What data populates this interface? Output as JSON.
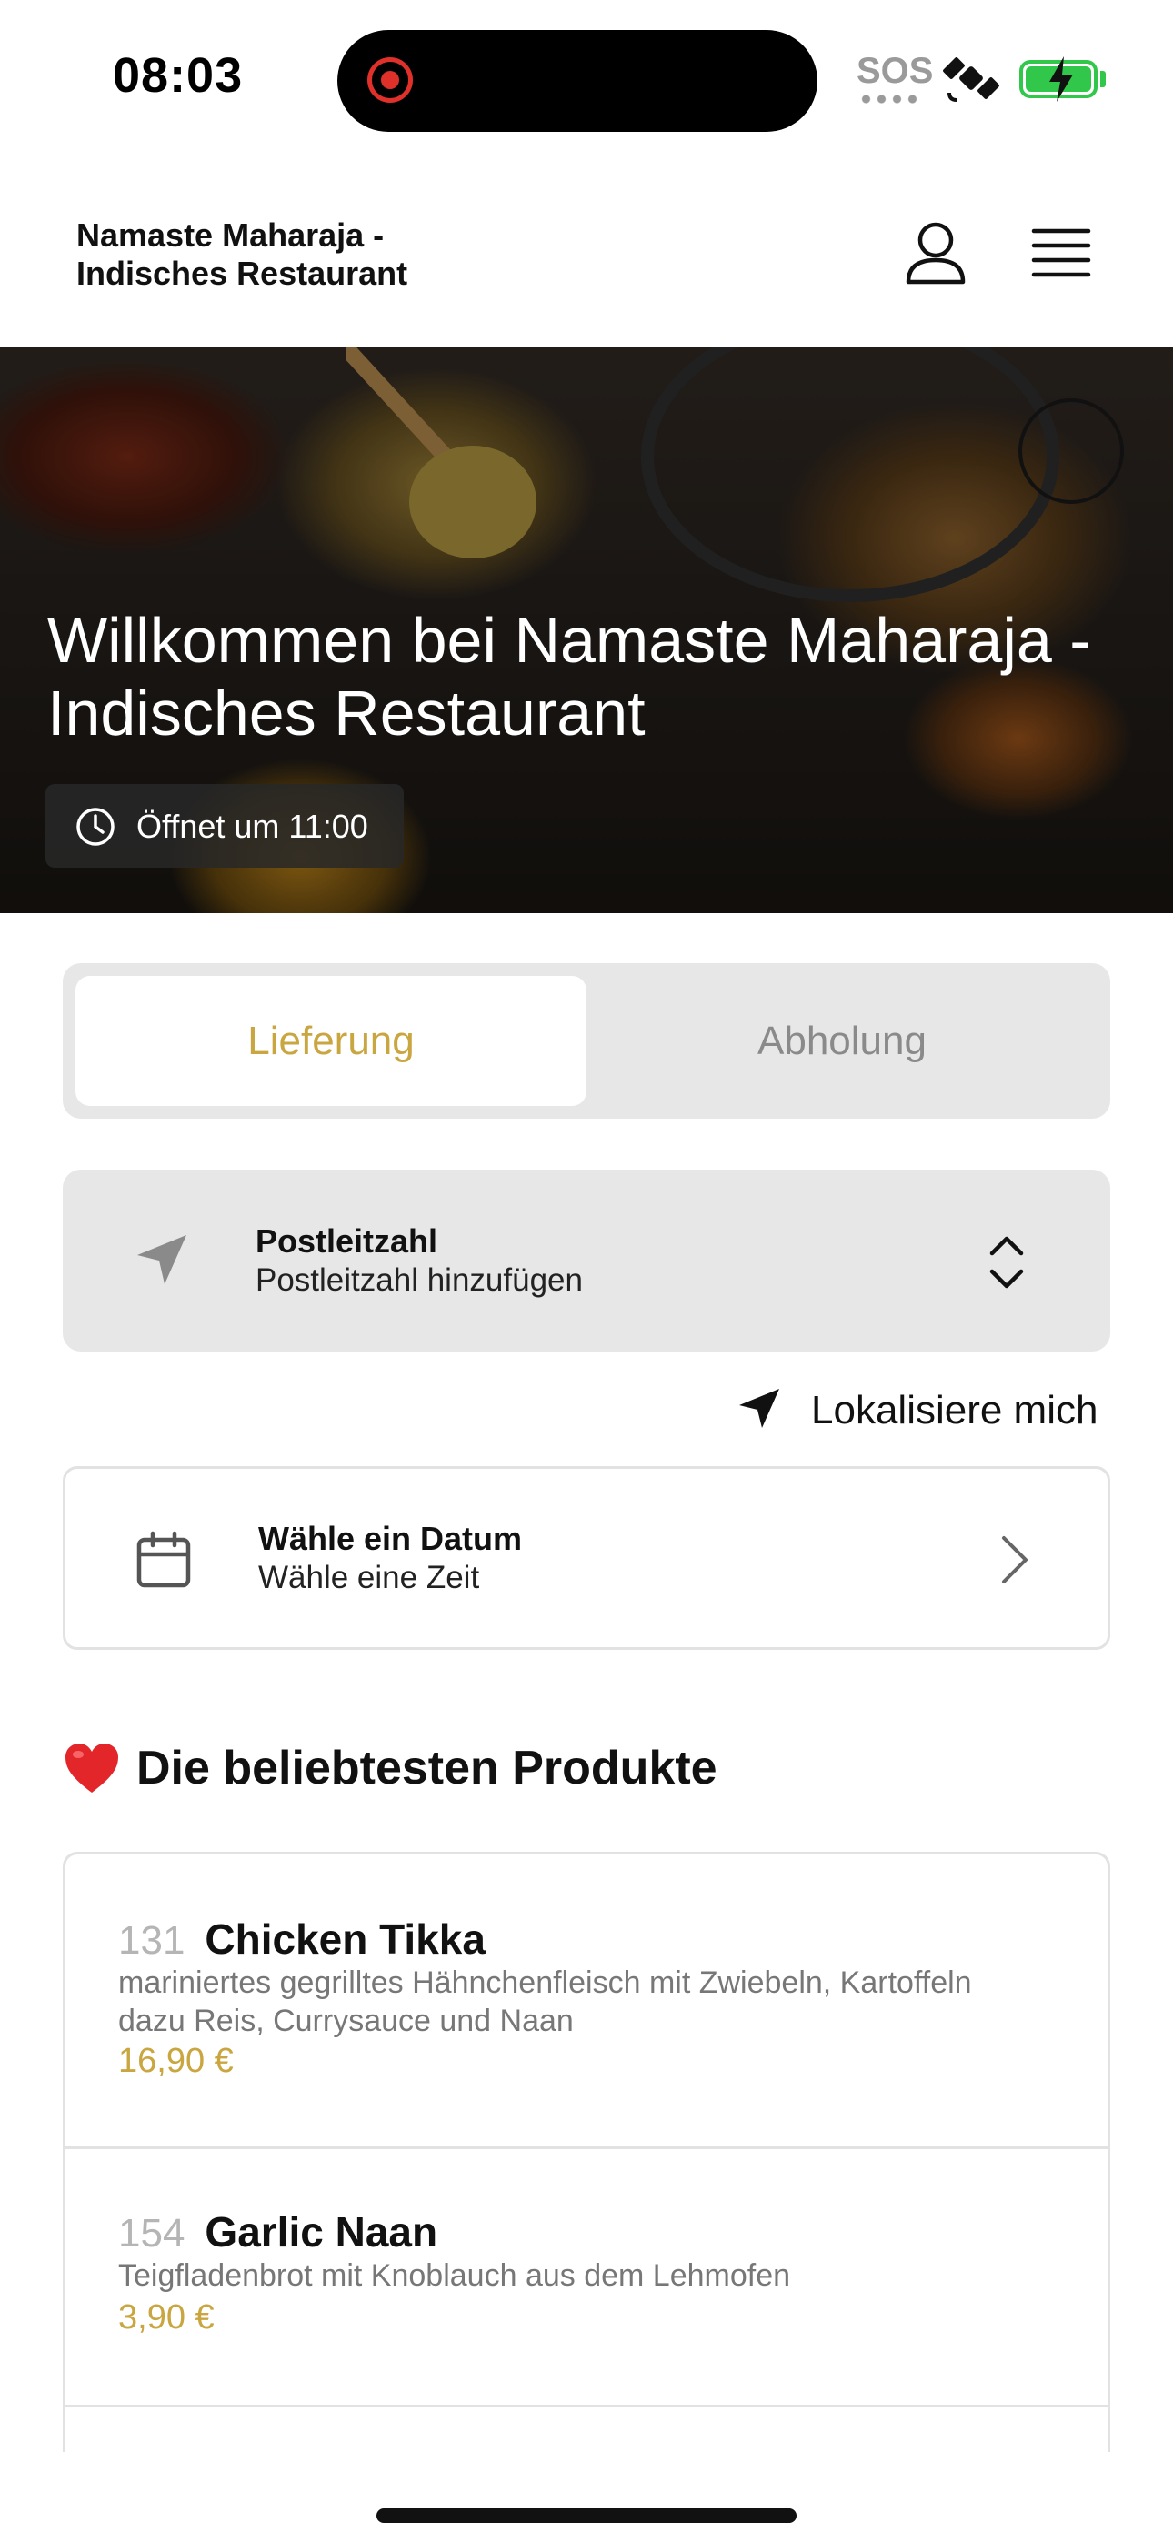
{
  "status_bar": {
    "time": "08:03",
    "sos": "SOS"
  },
  "header": {
    "restaurant_name": "Namaste Maharaja - Indisches Restaurant"
  },
  "hero": {
    "title": "Willkommen bei Namaste Maharaja - Indisches Restaurant",
    "hours": "Öffnet um 11:00"
  },
  "order_mode": {
    "tabs": [
      {
        "label": "Lieferung",
        "active": true
      },
      {
        "label": "Abholung",
        "active": false
      }
    ],
    "accent_color": "#c9a640"
  },
  "postcode": {
    "title": "Postleitzahl",
    "placeholder": "Postleitzahl hinzufügen"
  },
  "locate": {
    "label": "Lokalisiere mich"
  },
  "schedule": {
    "date_label": "Wähle ein Datum",
    "time_label": "Wähle eine Zeit"
  },
  "popular": {
    "heading": "Die beliebtesten Produkte",
    "icon": "heart-icon",
    "products": [
      {
        "number": "131",
        "name": "Chicken Tikka",
        "description": "mariniertes gegrilltes Hähnchenfleisch mit Zwiebeln, Kartoffeln dazu Reis, Currysauce und Naan",
        "price": "16,90 €"
      },
      {
        "number": "154",
        "name": "Garlic Naan",
        "description": "Teigfladenbrot mit Knoblauch aus dem Lehmofen",
        "price": "3,90 €"
      }
    ]
  }
}
